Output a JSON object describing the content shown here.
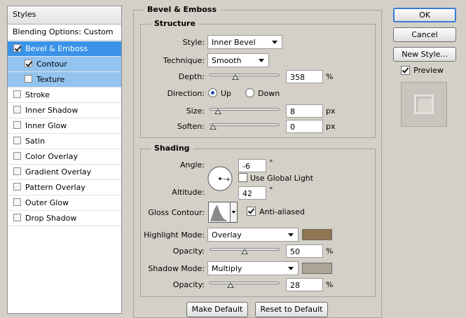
{
  "styles_panel": {
    "header": "Styles",
    "blending_options": "Blending Options: Custom",
    "items": [
      {
        "label": "Bevel & Emboss",
        "checked": true,
        "state": "selected"
      },
      {
        "label": "Contour",
        "checked": true,
        "state": "sub"
      },
      {
        "label": "Texture",
        "checked": false,
        "state": "sub"
      },
      {
        "label": "Stroke",
        "checked": false,
        "state": "normal"
      },
      {
        "label": "Inner Shadow",
        "checked": false,
        "state": "normal"
      },
      {
        "label": "Inner Glow",
        "checked": false,
        "state": "normal"
      },
      {
        "label": "Satin",
        "checked": false,
        "state": "normal"
      },
      {
        "label": "Color Overlay",
        "checked": false,
        "state": "normal"
      },
      {
        "label": "Gradient Overlay",
        "checked": false,
        "state": "normal"
      },
      {
        "label": "Pattern Overlay",
        "checked": false,
        "state": "normal"
      },
      {
        "label": "Outer Glow",
        "checked": false,
        "state": "normal"
      },
      {
        "label": "Drop Shadow",
        "checked": false,
        "state": "normal"
      }
    ]
  },
  "bevel": {
    "title": "Bevel & Emboss",
    "structure": {
      "title": "Structure",
      "style_label": "Style:",
      "style_value": "Inner Bevel",
      "technique_label": "Technique:",
      "technique_value": "Smooth",
      "depth_label": "Depth:",
      "depth_value": "358",
      "depth_unit": "%",
      "depth_slider_fraction": 0.35,
      "direction_label": "Direction:",
      "direction_up": "Up",
      "direction_down": "Down",
      "size_label": "Size:",
      "size_value": "8",
      "size_unit": "px",
      "size_slider_fraction": 0.08,
      "soften_label": "Soften:",
      "soften_value": "0",
      "soften_unit": "px",
      "soften_slider_fraction": 0.0
    },
    "shading": {
      "title": "Shading",
      "angle_label": "Angle:",
      "angle_value": "-6",
      "angle_unit": "°",
      "use_global_light": "Use Global Light",
      "altitude_label": "Altitude:",
      "altitude_value": "42",
      "altitude_unit": "°",
      "gloss_contour_label": "Gloss Contour:",
      "anti_aliased": "Anti-aliased",
      "highlight_mode_label": "Highlight Mode:",
      "highlight_mode_value": "Overlay",
      "highlight_color": "#8f7550",
      "highlight_opacity_label": "Opacity:",
      "highlight_opacity_value": "50",
      "highlight_opacity_unit": "%",
      "shadow_mode_label": "Shadow Mode:",
      "shadow_mode_value": "Multiply",
      "shadow_color": "#ada596",
      "shadow_opacity_label": "Opacity:",
      "shadow_opacity_value": "28",
      "shadow_opacity_unit": "%"
    },
    "make_default": "Make Default",
    "reset_default": "Reset to Default"
  },
  "buttons": {
    "ok": "OK",
    "cancel": "Cancel",
    "new_style": "New Style...",
    "preview": "Preview"
  }
}
